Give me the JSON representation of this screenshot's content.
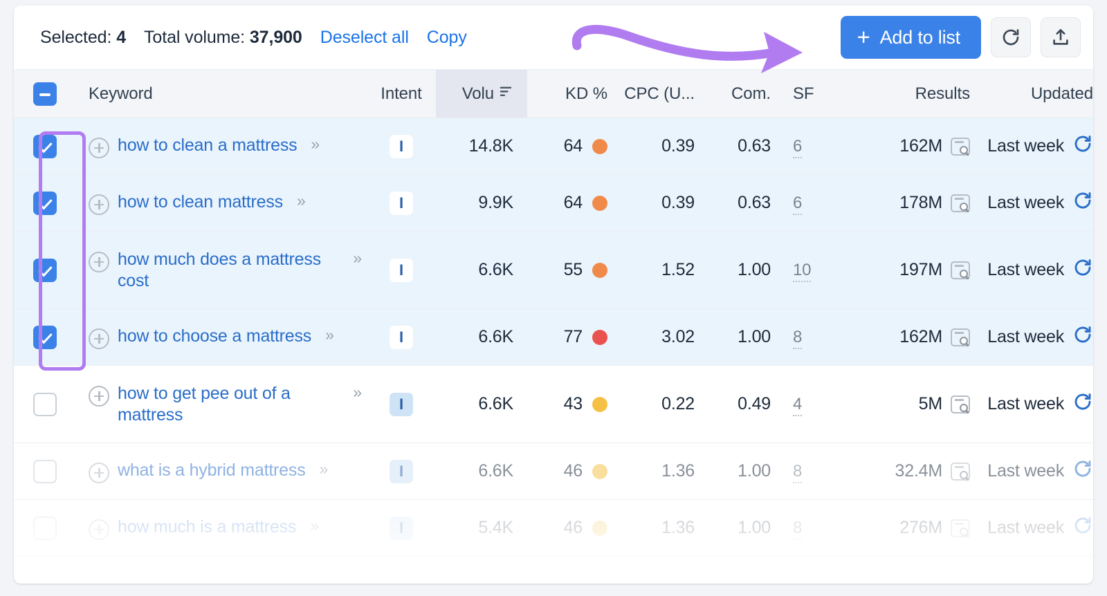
{
  "toolbar": {
    "selected_label": "Selected:",
    "selected_count": "4",
    "total_volume_label": "Total volume:",
    "total_volume_value": "37,900",
    "deselect_all": "Deselect all",
    "copy": "Copy",
    "add_to_list": "Add to list",
    "plus_glyph": "+",
    "refresh_icon": "refresh-icon",
    "export_icon": "export-icon"
  },
  "columns": {
    "keyword": "Keyword",
    "intent": "Intent",
    "volume": "Volu",
    "kd": "KD %",
    "cpc": "CPC (U...",
    "com": "Com.",
    "sf": "SF",
    "results": "Results",
    "updated": "Updated"
  },
  "colors": {
    "accent_blue": "#3b82e8",
    "link_blue": "#2a6dc9",
    "annotation_purple": "#b07cf0",
    "kd_orange": "#f08a4b",
    "kd_red": "#e9524f",
    "kd_yellow": "#f5c045",
    "selected_row": "#eaf4fc"
  },
  "chevron": "»",
  "rows": [
    {
      "keyword": "how to clean a mattress",
      "checked": true,
      "intent": "I",
      "volume": "14.8K",
      "kd": "64",
      "kd_color": "#f08a4b",
      "cpc": "0.39",
      "com": "0.63",
      "sf": "6",
      "results": "162M",
      "updated": "Last week"
    },
    {
      "keyword": "how to clean mattress",
      "checked": true,
      "intent": "I",
      "volume": "9.9K",
      "kd": "64",
      "kd_color": "#f08a4b",
      "cpc": "0.39",
      "com": "0.63",
      "sf": "6",
      "results": "178M",
      "updated": "Last week"
    },
    {
      "keyword": "how much does a mattress cost",
      "checked": true,
      "intent": "I",
      "volume": "6.6K",
      "kd": "55",
      "kd_color": "#f08a4b",
      "cpc": "1.52",
      "com": "1.00",
      "sf": "10",
      "results": "197M",
      "updated": "Last week"
    },
    {
      "keyword": "how to choose a mattress",
      "checked": true,
      "intent": "I",
      "volume": "6.6K",
      "kd": "77",
      "kd_color": "#e9524f",
      "cpc": "3.02",
      "com": "1.00",
      "sf": "8",
      "results": "162M",
      "updated": "Last week"
    },
    {
      "keyword": "how to get pee out of a mattress",
      "checked": false,
      "intent": "I",
      "volume": "6.6K",
      "kd": "43",
      "kd_color": "#f5c045",
      "cpc": "0.22",
      "com": "0.49",
      "sf": "4",
      "results": "5M",
      "updated": "Last week"
    },
    {
      "keyword": "what is a hybrid mattress",
      "checked": false,
      "intent": "I",
      "volume": "6.6K",
      "kd": "46",
      "kd_color": "#f5c045",
      "cpc": "1.36",
      "com": "1.00",
      "sf": "8",
      "results": "32.4M",
      "updated": "Last week"
    },
    {
      "keyword": "how much is a mattress",
      "checked": false,
      "intent": "I",
      "volume": "5.4K",
      "kd": "46",
      "kd_color": "#f5c045",
      "cpc": "1.36",
      "com": "1.00",
      "sf": "8",
      "results": "276M",
      "updated": "Last week"
    }
  ]
}
